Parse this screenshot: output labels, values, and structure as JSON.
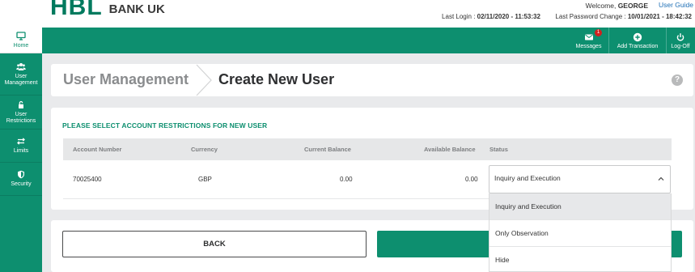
{
  "header": {
    "logo_main": "HBL",
    "logo_sub": "BANK UK",
    "welcome_prefix": "Welcome,",
    "username": "GEORGE",
    "user_guide": "User Guide",
    "last_login_label": "Last Login :",
    "last_login_value": "02/11/2020 - 11:53:32",
    "last_pwd_label": "Last Password Change :",
    "last_pwd_value": "10/01/2021 - 18:42:32"
  },
  "topbar": {
    "messages": {
      "label": "Messages",
      "badge": "1",
      "icon": "envelope-icon"
    },
    "add_transaction": {
      "label": "Add Transaction",
      "icon": "plus-circle-icon"
    },
    "logoff": {
      "label": "Log-Off",
      "icon": "power-icon"
    }
  },
  "sidebar": {
    "items": [
      {
        "label": "Home",
        "icon": "monitor-icon"
      },
      {
        "label": "User Management",
        "icon": "users-icon"
      },
      {
        "label": "User Restrictions",
        "icon": "lock-icon"
      },
      {
        "label": "Limits",
        "icon": "arrows-icon"
      },
      {
        "label": "Security",
        "icon": "shield-icon"
      }
    ]
  },
  "breadcrumb": {
    "parent": "User Management",
    "current": "Create New User"
  },
  "restrictions": {
    "title": "PLEASE SELECT ACCOUNT RESTRICTIONS FOR NEW USER",
    "columns": {
      "account_number": "Account Number",
      "currency": "Currency",
      "current_balance": "Current Balance",
      "available_balance": "Available Balance",
      "status": "Status"
    },
    "rows": [
      {
        "account_number": "70025400",
        "currency": "GBP",
        "current_balance": "0.00",
        "available_balance": "0.00",
        "status": "Inquiry and Execution"
      }
    ],
    "status_options": [
      "Inquiry and Execution",
      "Only Observation",
      "Hide"
    ]
  },
  "actions": {
    "back": "BACK"
  },
  "colors": {
    "brand_green": "#0d8f6f",
    "badge_red": "#d0201f",
    "background": "#e9eaec"
  }
}
